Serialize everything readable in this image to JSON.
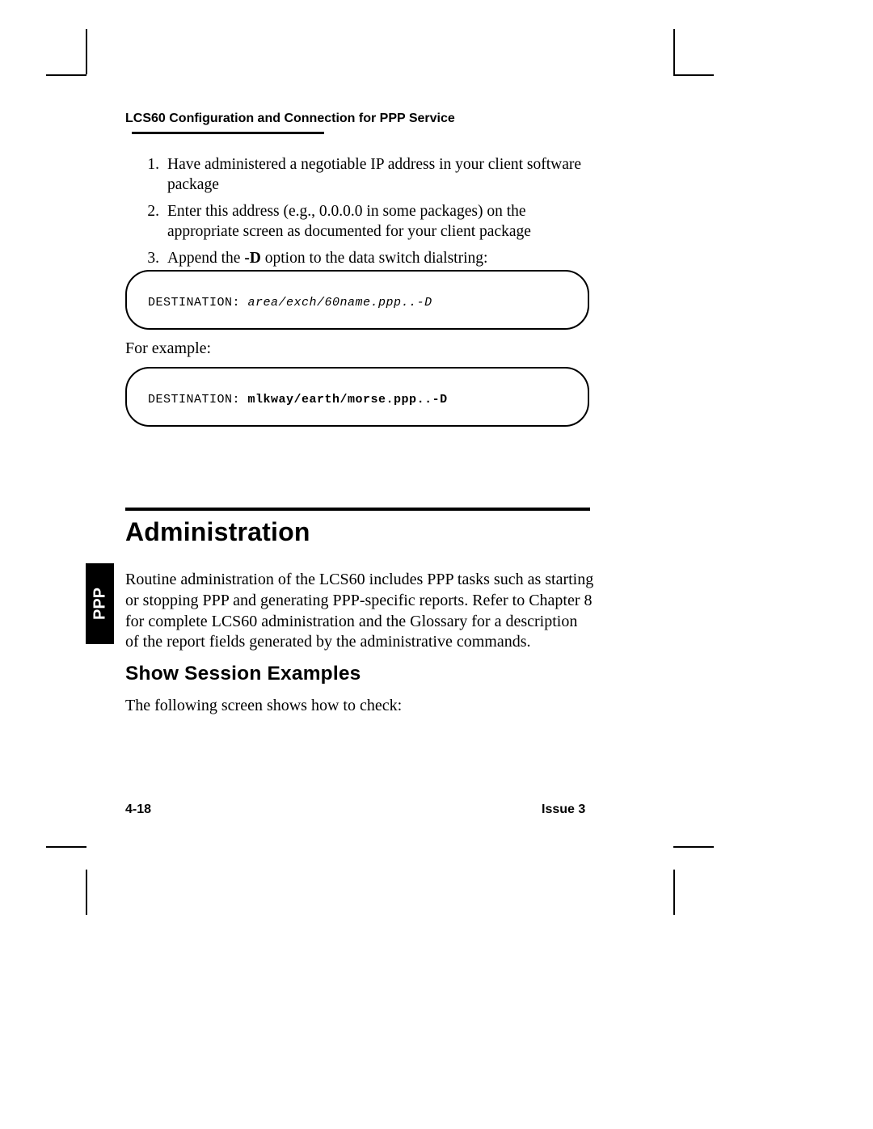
{
  "running_head": "LCS60 Configuration and Connection for PPP Service",
  "list": [
    {
      "num": "1.",
      "text": "Have administered a negotiable IP address in your client software package"
    },
    {
      "num": "2.",
      "text": "Enter this address (e.g., 0.0.0.0 in some packages) on the appropriate screen as documented for your client package"
    },
    {
      "num": "3.",
      "pre": "Append the ",
      "strong": "-D",
      "post": " option to the data switch dialstring:"
    }
  ],
  "oval_a": {
    "prompt": "DESTINATION: ",
    "arg": "area/exch/60name.ppp..-D"
  },
  "for_example": "For example:",
  "oval_b": {
    "prompt": "DESTINATION: ",
    "arg": "mlkway/earth/morse.ppp..-D"
  },
  "section_heading": "Administration",
  "thumb_tab": "PPP",
  "admin_body": "Routine administration of the LCS60 includes PPP tasks such as starting or stopping PPP and generating PPP-specific reports.  Refer to Chapter 8 for complete LCS60 administration and the Glossary for a description of the report fields generated by the administrative commands.",
  "subheading": "Show Session Examples",
  "sub_body": "The following screen shows how to check:",
  "footer": {
    "page": "4-18",
    "issue": "Issue 3"
  }
}
